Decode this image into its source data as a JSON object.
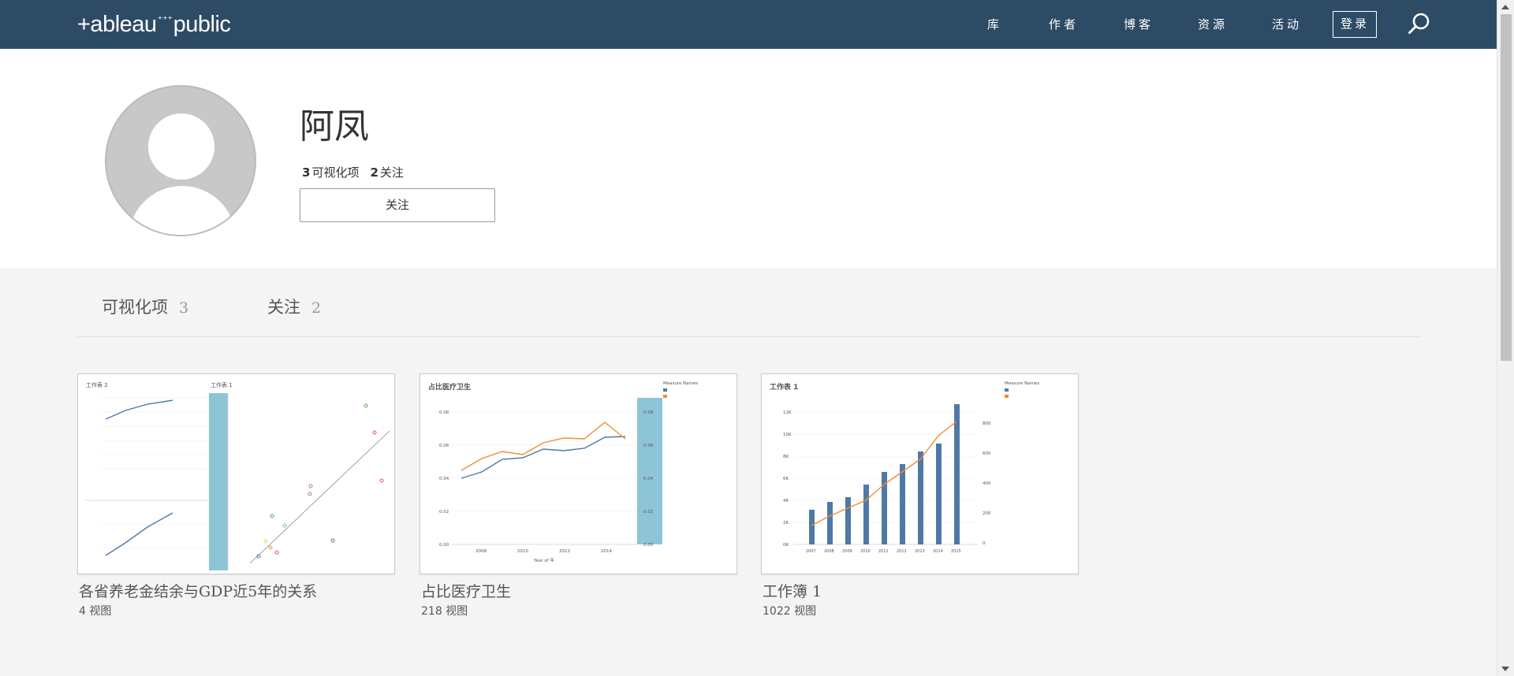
{
  "header": {
    "logo_text": "+ableau",
    "logo_spark": "⁺⁺⁺",
    "logo_suffix": "public",
    "nav": {
      "library": "库",
      "authors": "作者",
      "blog": "博客",
      "resources": "资源",
      "events": "活动"
    },
    "signin_label": "登录"
  },
  "profile": {
    "name": "阿凤",
    "viz_count": "3",
    "viz_label": "可视化项",
    "following_count": "2",
    "following_label": "关注",
    "follow_button": "关注"
  },
  "tabs": {
    "visualizations": {
      "label": "可视化项",
      "count": "3"
    },
    "following": {
      "label": "关注",
      "count": "2"
    }
  },
  "cards": [
    {
      "title": "各省养老金结余与GDP近5年的关系",
      "views": "4 视图",
      "thumb_sheet_a": "工作表 2",
      "thumb_sheet_b": "工作表 1"
    },
    {
      "title": "占比医疗卫生",
      "views": "218 视图",
      "thumb_title": "占比医疗卫生",
      "thumb_legend_title": "Measure Names",
      "thumb_xlabel": "Year of 年",
      "thumb_xticks": [
        "2008",
        "2010",
        "2012",
        "2014"
      ],
      "thumb_yticks_left": [
        "0.08",
        "0.06",
        "0.04",
        "0.02",
        "0.00"
      ],
      "thumb_yticks_right": [
        "0.08",
        "0.06",
        "0.04",
        "0.02",
        "0.00"
      ]
    },
    {
      "title": "工作簿 1",
      "views": "1022 视图",
      "thumb_title": "工作表 1",
      "thumb_legend_title": "Measure Names",
      "thumb_xticks": [
        "2007",
        "2008",
        "2009",
        "2010",
        "2011",
        "2012",
        "2013",
        "2014",
        "2015"
      ],
      "thumb_yticks_left": [
        "12K",
        "10K",
        "8K",
        "6K",
        "4K",
        "2K",
        "0K"
      ],
      "thumb_yticks_right": [
        "800",
        "600",
        "400",
        "200",
        "0"
      ]
    }
  ],
  "colors": {
    "header_bg": "#2e4b66",
    "series_blue": "#4e79a7",
    "series_orange": "#f28e2b",
    "band_teal": "#8ec5d6"
  }
}
